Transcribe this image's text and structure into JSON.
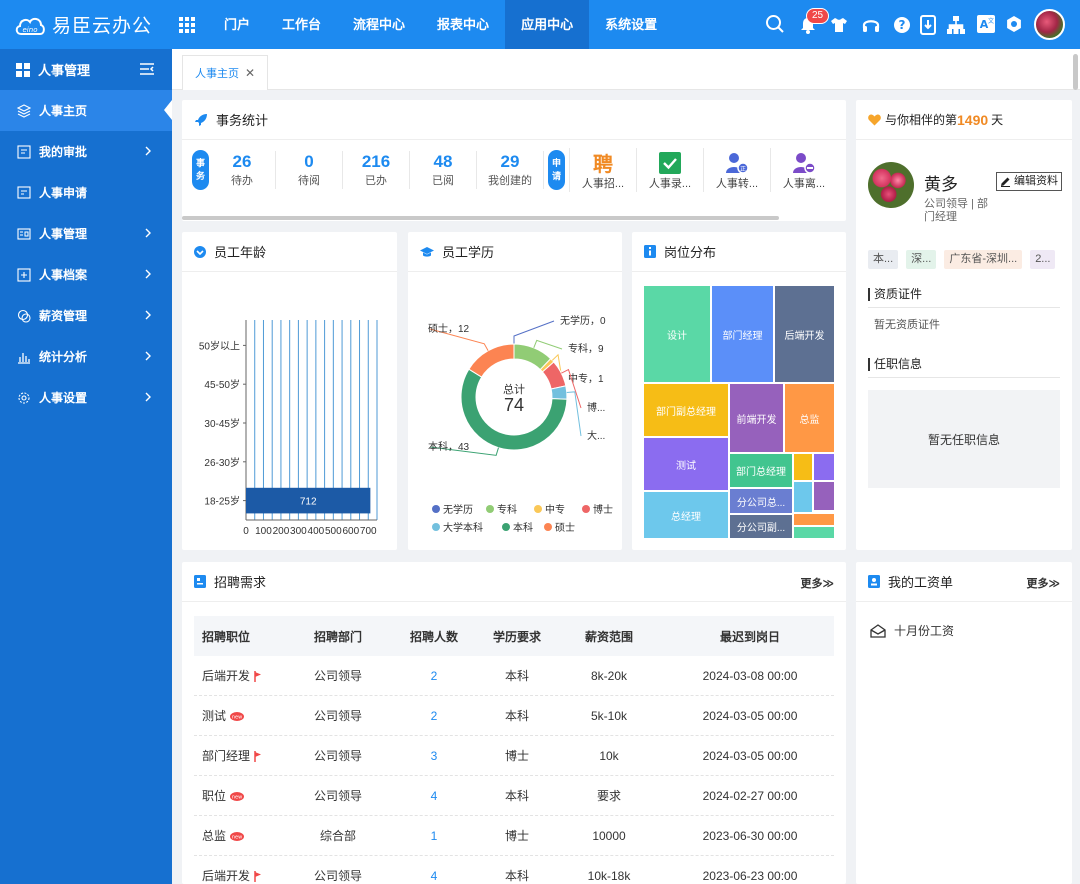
{
  "app": {
    "title": "易臣云办公"
  },
  "nav": {
    "items": [
      "门户",
      "工作台",
      "流程中心",
      "报表中心",
      "应用中心",
      "系统设置"
    ],
    "active_index": 4
  },
  "notifications": {
    "count": "25"
  },
  "sidebar": {
    "header": "人事管理",
    "items": [
      {
        "label": "人事主页",
        "active": true,
        "chevron": false
      },
      {
        "label": "我的审批",
        "chevron": true
      },
      {
        "label": "人事申请",
        "chevron": false
      },
      {
        "label": "人事管理",
        "chevron": true
      },
      {
        "label": "人事档案",
        "chevron": true
      },
      {
        "label": "薪资管理",
        "chevron": true
      },
      {
        "label": "统计分析",
        "chevron": true
      },
      {
        "label": "人事设置",
        "chevron": true
      }
    ]
  },
  "tab": {
    "label": "人事主页"
  },
  "affairs": {
    "title": "事务统计",
    "pill1": [
      "事",
      "务"
    ],
    "pill2": [
      "申",
      "请"
    ],
    "stats": [
      {
        "num": "26",
        "label": "待办"
      },
      {
        "num": "0",
        "label": "待阅"
      },
      {
        "num": "216",
        "label": "已办"
      },
      {
        "num": "48",
        "label": "已阅"
      },
      {
        "num": "29",
        "label": "我创建的"
      }
    ],
    "apps": [
      "人事招...",
      "人事录...",
      "人事转...",
      "人事离..."
    ]
  },
  "age": {
    "title": "员工年龄"
  },
  "edu": {
    "title": "员工学历"
  },
  "post": {
    "title": "岗位分布"
  },
  "chart_data": [
    {
      "type": "bar",
      "title": "员工年龄",
      "orientation": "horizontal",
      "categories": [
        "50岁以上",
        "45-50岁",
        "30-45岁",
        "26-30岁",
        "18-25岁"
      ],
      "values": [
        0,
        0,
        0,
        0,
        712
      ],
      "value_labels": [
        "",
        "",
        "",
        "",
        "712"
      ],
      "xticks": [
        "0",
        "100",
        "200",
        "300",
        "400",
        "500",
        "600",
        "700"
      ],
      "xlim": [
        0,
        750
      ]
    },
    {
      "type": "pie",
      "title": "员工学历",
      "donut": true,
      "center_label": "总计",
      "center_value": "74",
      "slices": [
        {
          "name": "无学历",
          "value": 0,
          "label": "无学历，0",
          "color": "#5470c6"
        },
        {
          "name": "专科",
          "value": 9,
          "label": "专科，9",
          "color": "#91cc75"
        },
        {
          "name": "中专",
          "value": 1,
          "label": "中专，1",
          "color": "#fac858"
        },
        {
          "name": "博士",
          "value": 6,
          "label": "博...",
          "color": "#ee6666"
        },
        {
          "name": "大学本科",
          "value": 3,
          "label": "大...",
          "color": "#73c0de"
        },
        {
          "name": "本科",
          "value": 43,
          "label": "本科，43",
          "color": "#3ba272"
        },
        {
          "name": "硕士",
          "value": 12,
          "label": "硕士，12",
          "color": "#fc8452"
        }
      ],
      "legend": [
        "无学历",
        "专科",
        "中专",
        "博士",
        "大学本科",
        "本科",
        "硕士"
      ]
    },
    {
      "type": "treemap",
      "title": "岗位分布",
      "items": [
        {
          "name": "设计",
          "value": 12,
          "color": "#5ad8a6"
        },
        {
          "name": "部门经理",
          "value": 11,
          "color": "#5b8ff9"
        },
        {
          "name": "后端开发",
          "value": 11,
          "color": "#5d7092"
        },
        {
          "name": "部门副总经理",
          "value": 9,
          "color": "#f6bd16"
        },
        {
          "name": "前端开发",
          "value": 8,
          "color": "#9661bc"
        },
        {
          "name": "总监",
          "value": 8,
          "color": "#ff9845"
        },
        {
          "name": "测试",
          "value": 9,
          "color": "#8b6cf0"
        },
        {
          "name": "部门总经理",
          "value": 4,
          "color": "#42c58f"
        },
        {
          "name": "总经理",
          "value": 8,
          "color": "#6dc8ec"
        },
        {
          "name": "分公司总...",
          "value": 4,
          "color": "#6a7ed1"
        },
        {
          "name": "分公司副...",
          "value": 4,
          "color": "#5d7092"
        }
      ]
    }
  ],
  "profile": {
    "greeting_pre": "与你相伴的第",
    "days": "1490",
    "greeting_post": "天",
    "name": "黄多",
    "role_line1": "公司领导 | 部",
    "role_line2": "门经理",
    "edit_label": "编辑资料",
    "tags": [
      {
        "text": "本...",
        "bg": "#e9ecf1"
      },
      {
        "text": "深...",
        "bg": "#e3f3ea"
      },
      {
        "text": "广东省-深圳...",
        "bg": "#fbece3"
      },
      {
        "text": "2...",
        "bg": "#efe9f5"
      }
    ],
    "cert_title": "资质证件",
    "cert_empty": "暂无资质证件",
    "job_title": "任职信息",
    "job_empty": "暂无任职信息"
  },
  "recruit": {
    "title": "招聘需求",
    "more": "更多≫",
    "headers": [
      "招聘职位",
      "招聘部门",
      "招聘人数",
      "学历要求",
      "薪资范围",
      "最迟到岗日"
    ],
    "rows": [
      [
        "后端开发",
        "公司领导",
        "2",
        "本科",
        "8k-20k",
        "2024-03-08 00:00"
      ],
      [
        "测试",
        "公司领导",
        "2",
        "本科",
        "5k-10k",
        "2024-03-05 00:00"
      ],
      [
        "部门经理",
        "公司领导",
        "3",
        "博士",
        "10k",
        "2024-03-05 00:00"
      ],
      [
        "职位",
        "公司领导",
        "4",
        "本科",
        "要求",
        "2024-02-27 00:00"
      ],
      [
        "总监",
        "综合部",
        "1",
        "博士",
        "10000",
        "2023-06-30 00:00"
      ],
      [
        "后端开发",
        "公司领导",
        "4",
        "本科",
        "10k-18k",
        "2023-06-23 00:00"
      ]
    ],
    "row_flags": [
      "flag",
      "new",
      "flag",
      "new",
      "new",
      "flag"
    ]
  },
  "salary": {
    "title": "我的工资单",
    "more": "更多≫",
    "item": "十月份工资"
  }
}
